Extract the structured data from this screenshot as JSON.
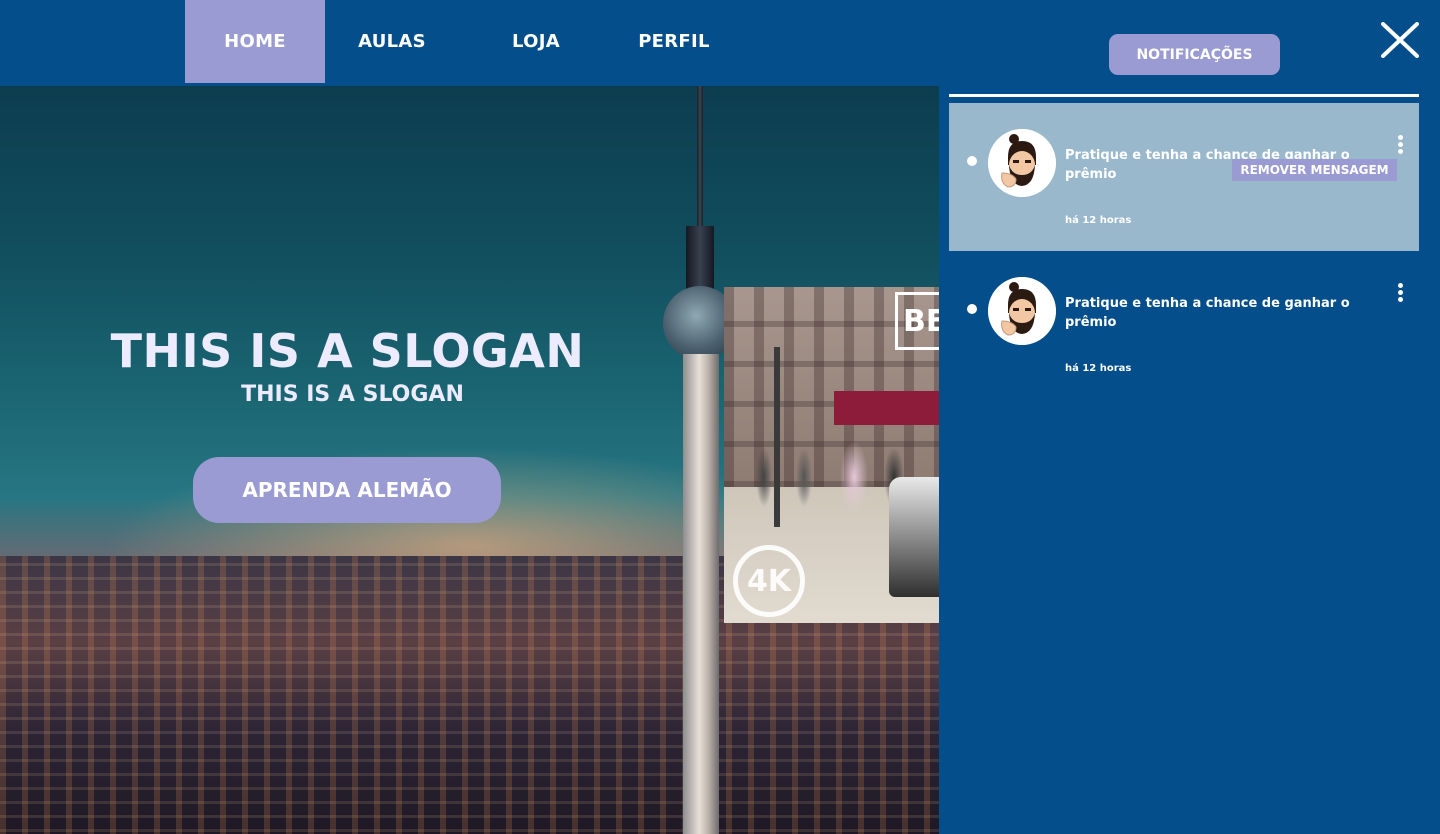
{
  "nav": {
    "items": [
      {
        "label": "HOME",
        "active": true
      },
      {
        "label": "AULAS",
        "active": false
      },
      {
        "label": "LOJA",
        "active": false
      },
      {
        "label": "PERFIL",
        "active": false
      }
    ]
  },
  "header": {
    "notifications_label": "NOTIFICAÇÕES",
    "close_icon": "close-icon"
  },
  "hero": {
    "title": "THIS IS A SLOGAN",
    "subtitle": "THIS IS A SLOGAN",
    "cta_label": "APRENDA ALEMÃO",
    "video_badge": "4K",
    "video_sign": "BE"
  },
  "notifications": [
    {
      "message": "Pratique e tenha a chance de ganhar o prêmio",
      "time": "há 12 horas",
      "unread": true,
      "menu_open": true,
      "menu_action": "REMOVER MENSAGEM"
    },
    {
      "message": "Pratique e tenha a chance de ganhar o prêmio",
      "time": "há 12 horas",
      "unread": true,
      "menu_open": false
    }
  ],
  "colors": {
    "background": "#034e8b",
    "accent": "#9a9bd3",
    "selected_row": "#9ab8cc",
    "text": "#ffffff"
  }
}
